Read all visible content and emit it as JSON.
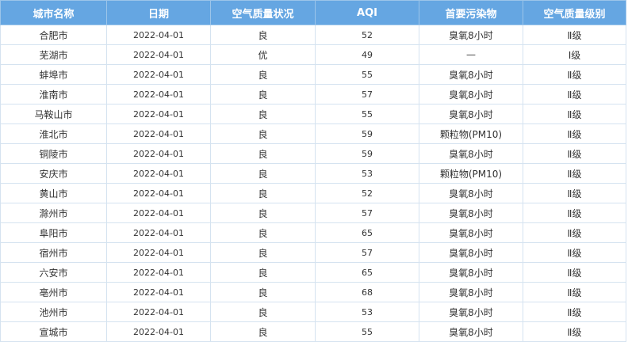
{
  "table": {
    "headers": [
      "城市名称",
      "日期",
      "空气质量状况",
      "AQI",
      "首要污染物",
      "空气质量级别"
    ],
    "rows": [
      [
        "合肥市",
        "2022-04-01",
        "良",
        "52",
        "臭氧8小时",
        "Ⅱ级"
      ],
      [
        "芜湖市",
        "2022-04-01",
        "优",
        "49",
        "—",
        "Ⅰ级"
      ],
      [
        "蚌埠市",
        "2022-04-01",
        "良",
        "55",
        "臭氧8小时",
        "Ⅱ级"
      ],
      [
        "淮南市",
        "2022-04-01",
        "良",
        "57",
        "臭氧8小时",
        "Ⅱ级"
      ],
      [
        "马鞍山市",
        "2022-04-01",
        "良",
        "55",
        "臭氧8小时",
        "Ⅱ级"
      ],
      [
        "淮北市",
        "2022-04-01",
        "良",
        "59",
        "颗粒物(PM10)",
        "Ⅱ级"
      ],
      [
        "铜陵市",
        "2022-04-01",
        "良",
        "59",
        "臭氧8小时",
        "Ⅱ级"
      ],
      [
        "安庆市",
        "2022-04-01",
        "良",
        "53",
        "颗粒物(PM10)",
        "Ⅱ级"
      ],
      [
        "黄山市",
        "2022-04-01",
        "良",
        "52",
        "臭氧8小时",
        "Ⅱ级"
      ],
      [
        "滁州市",
        "2022-04-01",
        "良",
        "57",
        "臭氧8小时",
        "Ⅱ级"
      ],
      [
        "阜阳市",
        "2022-04-01",
        "良",
        "65",
        "臭氧8小时",
        "Ⅱ级"
      ],
      [
        "宿州市",
        "2022-04-01",
        "良",
        "57",
        "臭氧8小时",
        "Ⅱ级"
      ],
      [
        "六安市",
        "2022-04-01",
        "良",
        "65",
        "臭氧8小时",
        "Ⅱ级"
      ],
      [
        "亳州市",
        "2022-04-01",
        "良",
        "68",
        "臭氧8小时",
        "Ⅱ级"
      ],
      [
        "池州市",
        "2022-04-01",
        "良",
        "53",
        "臭氧8小时",
        "Ⅱ级"
      ],
      [
        "宣城市",
        "2022-04-01",
        "良",
        "55",
        "臭氧8小时",
        "Ⅱ级"
      ]
    ]
  },
  "colors": {
    "header_bg": "#65a6e2",
    "header_text": "#ffffff",
    "border": "#d5e3f0"
  }
}
